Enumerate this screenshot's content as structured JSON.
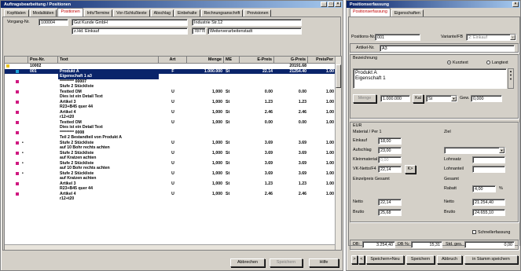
{
  "main": {
    "title": "Auftragsbearbeitung / Positionen",
    "tabs": [
      "Kopfdaten",
      "Modalitäten",
      "Positionen",
      "Info/Termine",
      "Vor-/Schlußtexte",
      "Abschlag",
      "Einbehalte",
      "Rechnungsanschrift",
      "Provisionen"
    ],
    "active_tab": "Positionen",
    "vorgang_label": "Vorgang-Nr.",
    "vorgang_nr": "100004",
    "customer_name": "Gut Kunde GmbH",
    "customer_contact": "z.Hd. Einkauf",
    "street": "Industrie Str.12",
    "zip": "78778",
    "city": "Weiterverarbeitenstadt",
    "columns": [
      "Pos-Nr.",
      "Text",
      "Art",
      "Menge",
      "ME",
      "E-Preis",
      "G-Preis",
      "PreisPer"
    ],
    "rows": [
      {
        "nr": "10002",
        "text": "",
        "art": "",
        "menge": "",
        "me": "",
        "ep": "",
        "gp": "20191.68",
        "pp": "",
        "mark": "y",
        "dot": false,
        "sel": false
      },
      {
        "nr": "001",
        "text": "Produkt A",
        "art": "F",
        "menge": "1.000.000",
        "me": "St",
        "ep": "22.14",
        "gp": "21254.40",
        "pp": "1.00",
        "mark": "c",
        "dot": false,
        "sel": true
      },
      {
        "nr": "",
        "text": "Eigenschaft 1 a3",
        "art": "",
        "menge": "",
        "me": "",
        "ep": "",
        "gp": "",
        "pp": "",
        "mark": "",
        "dot": false,
        "sel2": true
      },
      {
        "nr": "",
        "text": "********* 00007",
        "art": "",
        "menge": "",
        "me": "",
        "ep": "",
        "gp": "",
        "pp": "",
        "mark": "p",
        "dot": false
      },
      {
        "nr": "",
        "text": "Stufe 2 Stückliste",
        "art": "",
        "menge": "",
        "me": "",
        "ep": "",
        "gp": "",
        "pp": "",
        "mark": "",
        "dot": false
      },
      {
        "nr": "",
        "text": "Testted OM",
        "art": "U",
        "menge": "1,000",
        "me": "St",
        "ep": "0.00",
        "gp": "0.00",
        "pp": "1.00",
        "mark": "p",
        "dot": false
      },
      {
        "nr": "",
        "text": "Dies ist ein Detail Text",
        "art": "",
        "menge": "",
        "me": "",
        "ep": "",
        "gp": "",
        "pp": "",
        "mark": "",
        "dot": false
      },
      {
        "nr": "",
        "text": "Artikel 3",
        "art": "U",
        "menge": "1,000",
        "me": "St",
        "ep": "1.23",
        "gp": "1.23",
        "pp": "1.00",
        "mark": "p",
        "dot": false
      },
      {
        "nr": "",
        "text": "R23+B45 quer 44",
        "art": "",
        "menge": "",
        "me": "",
        "ep": "",
        "gp": "",
        "pp": "",
        "mark": "",
        "dot": false
      },
      {
        "nr": "",
        "text": "Artikel 4",
        "art": "U",
        "menge": "1,000",
        "me": "St",
        "ep": "2.46",
        "gp": "2.46",
        "pp": "1.00",
        "mark": "p",
        "dot": false
      },
      {
        "nr": "",
        "text": "r12+t20",
        "art": "",
        "menge": "",
        "me": "",
        "ep": "",
        "gp": "",
        "pp": "",
        "mark": "",
        "dot": false
      },
      {
        "nr": "",
        "text": "Testted OM",
        "art": "U",
        "menge": "1,000",
        "me": "St",
        "ep": "0.00",
        "gp": "0.00",
        "pp": "1.00",
        "mark": "p",
        "dot": false
      },
      {
        "nr": "",
        "text": "Dies ist ein Detail Text",
        "art": "",
        "menge": "",
        "me": "",
        "ep": "",
        "gp": "",
        "pp": "",
        "mark": "",
        "dot": false
      },
      {
        "nr": "",
        "text": "********* 0008",
        "art": "",
        "menge": "",
        "me": "",
        "ep": "",
        "gp": "",
        "pp": "",
        "mark": "p",
        "dot": false
      },
      {
        "nr": "",
        "text": "Teil 2 Bestandteil von Produkt A",
        "art": "",
        "menge": "",
        "me": "",
        "ep": "",
        "gp": "",
        "pp": "",
        "mark": "",
        "dot": false
      },
      {
        "nr": "",
        "text": "Stufe 2 Stückliste",
        "art": "U",
        "menge": "1,000",
        "me": "St",
        "ep": "3.69",
        "gp": "3.69",
        "pp": "1.00",
        "mark": "p",
        "dot": true
      },
      {
        "nr": "",
        "text": "auf 10 Bohr rechts achten",
        "art": "",
        "menge": "",
        "me": "",
        "ep": "",
        "gp": "",
        "pp": "",
        "mark": "",
        "dot": false
      },
      {
        "nr": "",
        "text": "Stufe 2 Stückliste",
        "art": "U",
        "menge": "1,000",
        "me": "St",
        "ep": "3.69",
        "gp": "3.69",
        "pp": "1.00",
        "mark": "p",
        "dot": true
      },
      {
        "nr": "",
        "text": "auf Kratzen achten",
        "art": "",
        "menge": "",
        "me": "",
        "ep": "",
        "gp": "",
        "pp": "",
        "mark": "",
        "dot": false
      },
      {
        "nr": "",
        "text": "Stufe 2 Stückliste",
        "art": "U",
        "menge": "1,000",
        "me": "St",
        "ep": "3.69",
        "gp": "3.69",
        "pp": "1.00",
        "mark": "p",
        "dot": true
      },
      {
        "nr": "",
        "text": "auf 10 Bohr rechts achten",
        "art": "",
        "menge": "",
        "me": "",
        "ep": "",
        "gp": "",
        "pp": "",
        "mark": "",
        "dot": false
      },
      {
        "nr": "",
        "text": "Stufe 2 Stückliste",
        "art": "U",
        "menge": "1,000",
        "me": "St",
        "ep": "3.69",
        "gp": "3.69",
        "pp": "1.00",
        "mark": "p",
        "dot": true
      },
      {
        "nr": "",
        "text": "auf Kratzen achten",
        "art": "",
        "menge": "",
        "me": "",
        "ep": "",
        "gp": "",
        "pp": "",
        "mark": "",
        "dot": false
      },
      {
        "nr": "",
        "text": "Artikel 3",
        "art": "U",
        "menge": "1,000",
        "me": "St",
        "ep": "1.23",
        "gp": "1.23",
        "pp": "1.00",
        "mark": "p",
        "dot": false
      },
      {
        "nr": "",
        "text": "R23+B45 quer 44",
        "art": "",
        "menge": "",
        "me": "",
        "ep": "",
        "gp": "",
        "pp": "",
        "mark": "",
        "dot": false
      },
      {
        "nr": "",
        "text": "Artikel 4",
        "art": "U",
        "menge": "1,000",
        "me": "St",
        "ep": "2.46",
        "gp": "2.46",
        "pp": "1.00",
        "mark": "p",
        "dot": false
      },
      {
        "nr": "",
        "text": "r12+t20",
        "art": "",
        "menge": "",
        "me": "",
        "ep": "",
        "gp": "",
        "pp": "",
        "mark": "",
        "dot": false
      }
    ],
    "buttons": {
      "cancel": "Abbrechen",
      "save": "Speichern",
      "help": "Hilfe"
    }
  },
  "dialog": {
    "title": "Positionserfassung",
    "tabs": [
      "Positionserfassung",
      "Eigenschaften"
    ],
    "pos_label": "Positions-Nr.",
    "pos_value": "001",
    "variant_label": "Variante/FB",
    "variant_value": "2: Einkauf",
    "article_label": "Artikel-Nr.",
    "article_value": "A3",
    "desc_label": "Bezeichnung",
    "radio_short": "Kurztext",
    "radio_long": "Langtext",
    "desc_line1": "Produkt A",
    "desc_line2": "Eigenschaft 1",
    "menge_btn": "Menge",
    "menge_value": "1.000.000",
    "kal_btn": "Kal",
    "unit_value": "St",
    "gew_label": "Gew.",
    "gew_value": "0,000",
    "currency": "EUR",
    "ziel_label": "Ziel",
    "mat_label": "Material / Per 1",
    "einkauf_label": "Einkauf",
    "einkauf_value": "18,00",
    "aufschlag_label": "Aufschlag",
    "aufschlag_value": "23,00",
    "kleinmat_label": "Kleinmaterial",
    "kleinmat_value": "0,00",
    "lohnsatz_label": "Lohnsatz",
    "vk_label": "VK-Netto/F4",
    "vk_value": "22,14",
    "k_btn": "K>",
    "lohnanteil_label": "Lohnanteil",
    "einzelpreis_label": "Einzelpreis Gesamt",
    "gesamt_label": "Gesamt",
    "rabatt_label": "Rabatt",
    "rabatt_value": "4,00",
    "rabatt_unit": "%",
    "netto_label": "Netto",
    "netto_left": "22,14",
    "netto_right": "21.254,40",
    "brutto_label": "Brutto",
    "brutto_left": "25,68",
    "brutto_right": "24.655,10",
    "quick_label": "Schnellerfassung",
    "db_label": "DB:",
    "db_value": "3.254,40",
    "db_pct_label": "DB %:",
    "db_pct_value": "15,31",
    "std_label": "Std. ges.",
    "std_value": "0,00",
    "buttons": {
      "prev": ">",
      "prev2": "<",
      "save_new": "Speichern+Neu",
      "save": "Speichern",
      "cancel": "Abbruch",
      "save_master": "in Stamm speichern"
    }
  }
}
